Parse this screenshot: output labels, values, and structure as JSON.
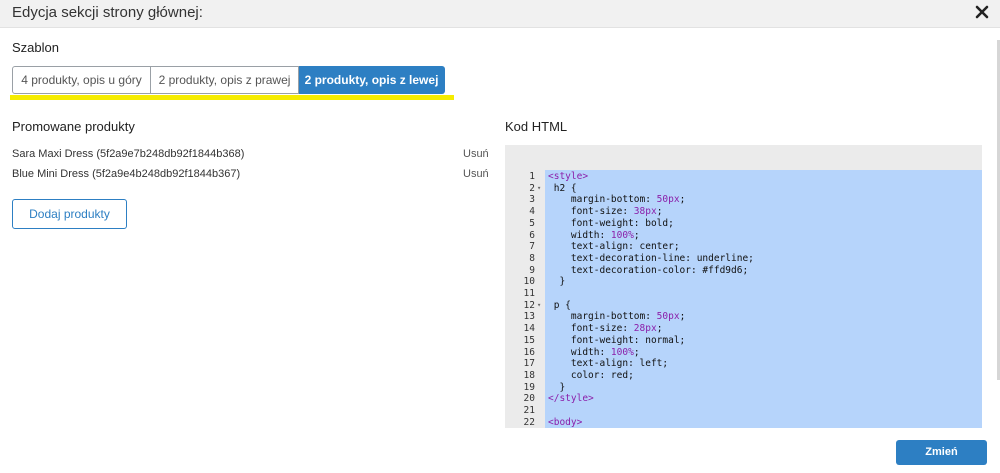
{
  "dialog": {
    "title": "Edycja sekcji strony głównej:",
    "close_icon": "close-icon"
  },
  "template": {
    "label": "Szablon",
    "tabs": [
      {
        "label": "4 produkty, opis u góry",
        "active": false
      },
      {
        "label": "2 produkty, opis z prawej",
        "active": false
      },
      {
        "label": "2 produkty, opis z lewej",
        "active": true
      }
    ]
  },
  "promoted": {
    "label": "Promowane produkty",
    "items": [
      {
        "name": "Sara Maxi Dress (5f2a9e7b248db92f1844b368)",
        "remove": "Usuń"
      },
      {
        "name": "Blue Mini Dress (5f2a9e4b248db92f1844b367)",
        "remove": "Usuń"
      }
    ],
    "add_button": "Dodaj produkty"
  },
  "html_editor": {
    "label": "Kod HTML",
    "lines": [
      {
        "n": "1",
        "fold": false,
        "text": "<style>"
      },
      {
        "n": "2",
        "fold": true,
        "text": " h2 {"
      },
      {
        "n": "3",
        "fold": false,
        "text": "    margin-bottom: 50px;"
      },
      {
        "n": "4",
        "fold": false,
        "text": "    font-size: 38px;"
      },
      {
        "n": "5",
        "fold": false,
        "text": "    font-weight: bold;"
      },
      {
        "n": "6",
        "fold": false,
        "text": "    width: 100%;"
      },
      {
        "n": "7",
        "fold": false,
        "text": "    text-align: center;"
      },
      {
        "n": "8",
        "fold": false,
        "text": "    text-decoration-line: underline;"
      },
      {
        "n": "9",
        "fold": false,
        "text": "    text-decoration-color: #ffd9d6;"
      },
      {
        "n": "10",
        "fold": false,
        "text": "  }"
      },
      {
        "n": "11",
        "fold": false,
        "text": ""
      },
      {
        "n": "12",
        "fold": true,
        "text": " p {"
      },
      {
        "n": "13",
        "fold": false,
        "text": "    margin-bottom: 50px;"
      },
      {
        "n": "14",
        "fold": false,
        "text": "    font-size: 28px;"
      },
      {
        "n": "15",
        "fold": false,
        "text": "    font-weight: normal;"
      },
      {
        "n": "16",
        "fold": false,
        "text": "    width: 100%;"
      },
      {
        "n": "17",
        "fold": false,
        "text": "    text-align: left;"
      },
      {
        "n": "18",
        "fold": false,
        "text": "    color: red;"
      },
      {
        "n": "19",
        "fold": false,
        "text": "  }"
      },
      {
        "n": "20",
        "fold": false,
        "text": "</style>"
      },
      {
        "n": "21",
        "fold": false,
        "text": ""
      },
      {
        "n": "22",
        "fold": false,
        "text": "<body>"
      }
    ]
  },
  "footer": {
    "save_button": "Zmień"
  },
  "colors": {
    "accent": "#2d7fc3",
    "highlight": "#f5ec00",
    "selection": "#b6d4fb"
  }
}
